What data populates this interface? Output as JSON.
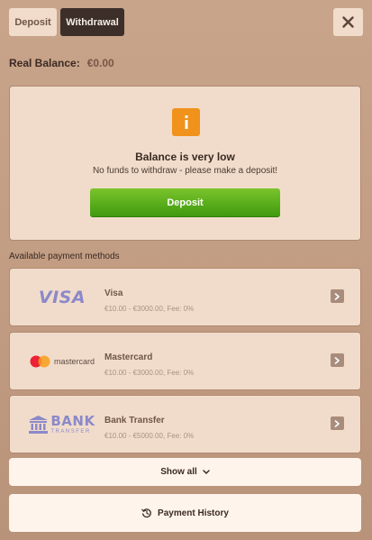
{
  "tabs": {
    "deposit_label": "Deposit",
    "withdrawal_label": "Withdrawal",
    "active": "withdrawal"
  },
  "close_icon": "close-icon",
  "balance": {
    "label": "Real Balance:",
    "amount": "€0.00"
  },
  "notice": {
    "icon": "info-icon",
    "title": "Balance is very low",
    "message": "No funds to withdraw - please make a deposit!",
    "button_label": "Deposit"
  },
  "payment_methods": {
    "section_label": "Available payment methods",
    "items": [
      {
        "name": "Visa",
        "details": "€10.00 - €3000.00, Fee: 0%",
        "logo": "VISA"
      },
      {
        "name": "Mastercard",
        "details": "€10.00 - €3000.00, Fee: 0%",
        "logo": "mastercard"
      },
      {
        "name": "Bank Transfer",
        "details": "€10.00 - €5000.00, Fee: 0%",
        "logo": "BANK",
        "logo_sub": "TRANSFER"
      }
    ]
  },
  "show_all_label": "Show all",
  "history_label": "Payment History",
  "colors": {
    "active_tab": "#3c2f2a",
    "panel_bg": "#f1dccb",
    "accent_orange": "#f0921b",
    "deposit_green": "#55ab18",
    "logo_purple": "#8b89c9"
  }
}
